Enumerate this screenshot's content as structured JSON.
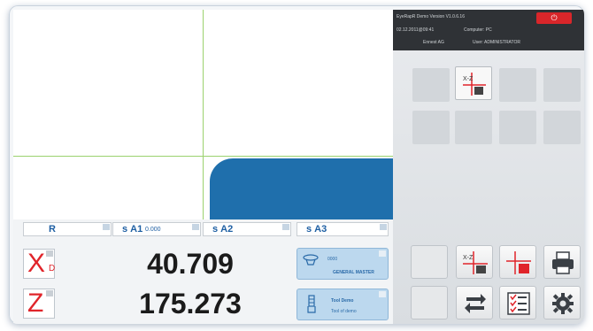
{
  "header": {
    "app_version": "EyeRapR Demo Version   V1.0.6.16",
    "datetime": "02.12.2011@09:41",
    "computer": "Computer: PC",
    "company": "Ennest AG",
    "user": "User: ADMINISTRATOR",
    "power_icon": "power-icon"
  },
  "axis_headers": [
    {
      "label": "R",
      "value": ""
    },
    {
      "label": "ѕ A1",
      "value": "0.000"
    },
    {
      "label": "ѕ A2",
      "value": ""
    },
    {
      "label": "ѕ A3",
      "value": ""
    }
  ],
  "readouts": [
    {
      "axis": "X",
      "subscript": "D",
      "value": "40.709"
    },
    {
      "axis": "Z",
      "subscript": "",
      "value": "175.273"
    }
  ],
  "holder_card": {
    "line1": "0000",
    "line2": "GENERAL MASTER"
  },
  "tool_card": {
    "line1": "Tool Demo",
    "line2": "Tool of demo"
  },
  "icons": {
    "grid_active": "xz-view-icon",
    "buttons": [
      "blank",
      "xz-view-icon",
      "crosshair-icon",
      "print-icon",
      "blank",
      "transfer-icon",
      "checklist-icon",
      "gear-icon"
    ]
  },
  "colors": {
    "accent_blue": "#1f6fac",
    "crosshair_green": "#9bd26e",
    "red": "#e0242a"
  }
}
